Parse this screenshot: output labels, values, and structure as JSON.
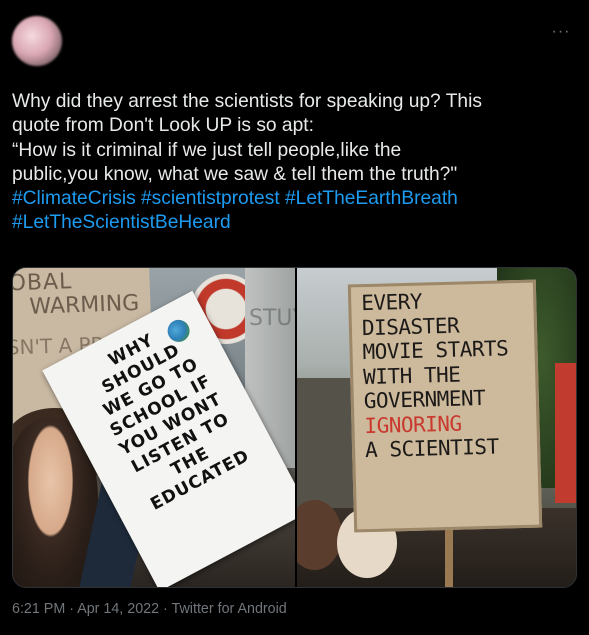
{
  "tweet": {
    "lines": [
      "Why did they arrest the scientists for speaking up? This",
      "quote from Don't Look UP is so apt:",
      "“How is it criminal if we just tell people,like the",
      "public,you know, what we saw & tell them the truth?\""
    ],
    "hashtags_line1": [
      "#ClimateCrisis",
      "#scientistprotest",
      "#LetTheEarthBreath"
    ],
    "hashtags_line2": [
      "#LetTheScientistBeHeard"
    ],
    "more_icon": "more-horizontal-icon",
    "meta": {
      "time": "6:21 PM",
      "date": "Apr 14, 2022",
      "source": "Twitter for Android"
    }
  },
  "media": {
    "left_photo": {
      "bg_sign_lines": [
        "OBAL",
        "WARMING",
        "SN'T A PRE"
      ],
      "building_text": "STUYOUNON",
      "sign_lines": [
        "WHY",
        "SHOULD",
        "WE GO TO",
        "SCHOOL IF",
        "YOU WONT",
        "LISTEN TO",
        "THE",
        "EDUCATED"
      ]
    },
    "right_photo": {
      "sign_lines": [
        "EVERY",
        "DISASTER",
        "MOVIE STARTS",
        "WITH THE",
        "GOVERNMENT"
      ],
      "sign_highlight": "IGNORING",
      "sign_last": "A SCIENTIST"
    }
  }
}
